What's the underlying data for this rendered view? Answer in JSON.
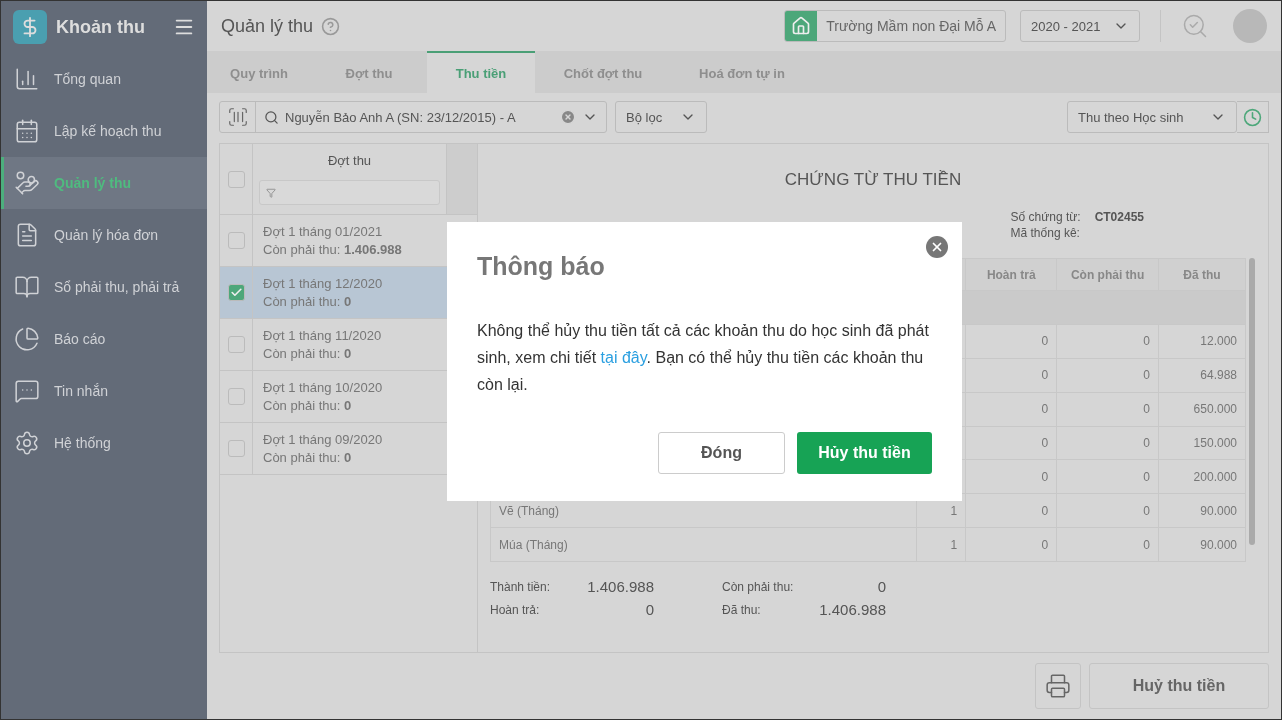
{
  "sidebar": {
    "app_title": "Khoản thu",
    "items": [
      {
        "label": "Tổng quan",
        "selected": false
      },
      {
        "label": "Lập kế hoạch thu",
        "selected": false
      },
      {
        "label": "Quản lý thu",
        "selected": true
      },
      {
        "label": "Quản lý hóa đơn",
        "selected": false
      },
      {
        "label": "Sổ phải thu, phải trả",
        "selected": false
      },
      {
        "label": "Báo cáo",
        "selected": false
      },
      {
        "label": "Tin nhắn",
        "selected": false
      },
      {
        "label": "Hệ thống",
        "selected": false
      }
    ]
  },
  "header": {
    "title": "Quản lý thu",
    "school": "Trường Mầm non Đại Mỗ A",
    "year": "2020 - 2021"
  },
  "tabs": [
    {
      "label": "Quy trình",
      "selected": false
    },
    {
      "label": "Đợt thu",
      "selected": false
    },
    {
      "label": "Thu tiền",
      "selected": true
    },
    {
      "label": "Chốt đợt thu",
      "selected": false
    },
    {
      "label": "Hoá đơn tự in",
      "selected": false
    }
  ],
  "toolbar": {
    "student": "Nguyễn Bảo Anh A (SN: 23/12/2015) - A",
    "filter": "Bộ lọc",
    "mode": "Thu theo Học sinh"
  },
  "batches": {
    "header": "Đợt thu",
    "all_checked": false,
    "items": [
      {
        "title": "Đợt 1 tháng 01/2021",
        "label": "Còn phải thu:",
        "amount": "1.406.988",
        "checked": false
      },
      {
        "title": "Đợt 1 tháng 12/2020",
        "label": "Còn phải thu:",
        "amount": "0",
        "checked": true
      },
      {
        "title": "Đợt 1 tháng 11/2020",
        "label": "Còn phải thu:",
        "amount": "0",
        "checked": false
      },
      {
        "title": "Đợt 1 tháng 10/2020",
        "label": "Còn phải thu:",
        "amount": "0",
        "checked": false
      },
      {
        "title": "Đợt 1 tháng 09/2020",
        "label": "Còn phải thu:",
        "amount": "0",
        "checked": false
      }
    ]
  },
  "receipt": {
    "title": "CHỨNG TỪ THU TIỀN",
    "doc_no_label": "Số chứng từ:",
    "doc_no": "CT02455",
    "stat_label": "Mã thống kê:",
    "columns": [
      "Hoàn trả",
      "Còn phải thu",
      "Đã thu"
    ],
    "rows": [
      {
        "kind": "group"
      },
      {
        "kind": "item",
        "refund": "0",
        "remaining": "0",
        "paid": "12.000"
      },
      {
        "kind": "item",
        "refund": "0",
        "remaining": "0",
        "paid": "64.988"
      },
      {
        "kind": "item",
        "refund": "0",
        "remaining": "0",
        "paid": "650.000"
      },
      {
        "kind": "item",
        "refund": "0",
        "remaining": "0",
        "paid": "150.000"
      },
      {
        "kind": "item",
        "refund": "0",
        "remaining": "0",
        "paid": "200.000"
      },
      {
        "kind": "item",
        "name": "Vẽ (Tháng)",
        "qty": "1",
        "refund": "0",
        "remaining": "0",
        "paid": "90.000"
      },
      {
        "kind": "item",
        "name": "Múa (Tháng)",
        "qty": "1",
        "refund": "0",
        "remaining": "0",
        "paid": "90.000"
      }
    ],
    "totals": [
      {
        "label": "Thành tiền:",
        "value": "1.406.988"
      },
      {
        "label": "Còn phải thu:",
        "value": "0"
      },
      {
        "label": "Hoàn trả:",
        "value": "0"
      },
      {
        "label": "Đã thu:",
        "value": "1.406.988"
      }
    ]
  },
  "actions": {
    "cancel": "Huỷ thu tiền"
  },
  "dialog": {
    "title": "Thông báo",
    "message_before": "Không thể hủy thu tiền tất cả các khoản thu do học sinh đã phát sinh, xem chi tiết ",
    "link": "tại đây",
    "message_after": ". Bạn có thể hủy thu tiền các khoản thu còn lại.",
    "close_button": "Đóng",
    "confirm_button": "Hủy thu tiền"
  }
}
